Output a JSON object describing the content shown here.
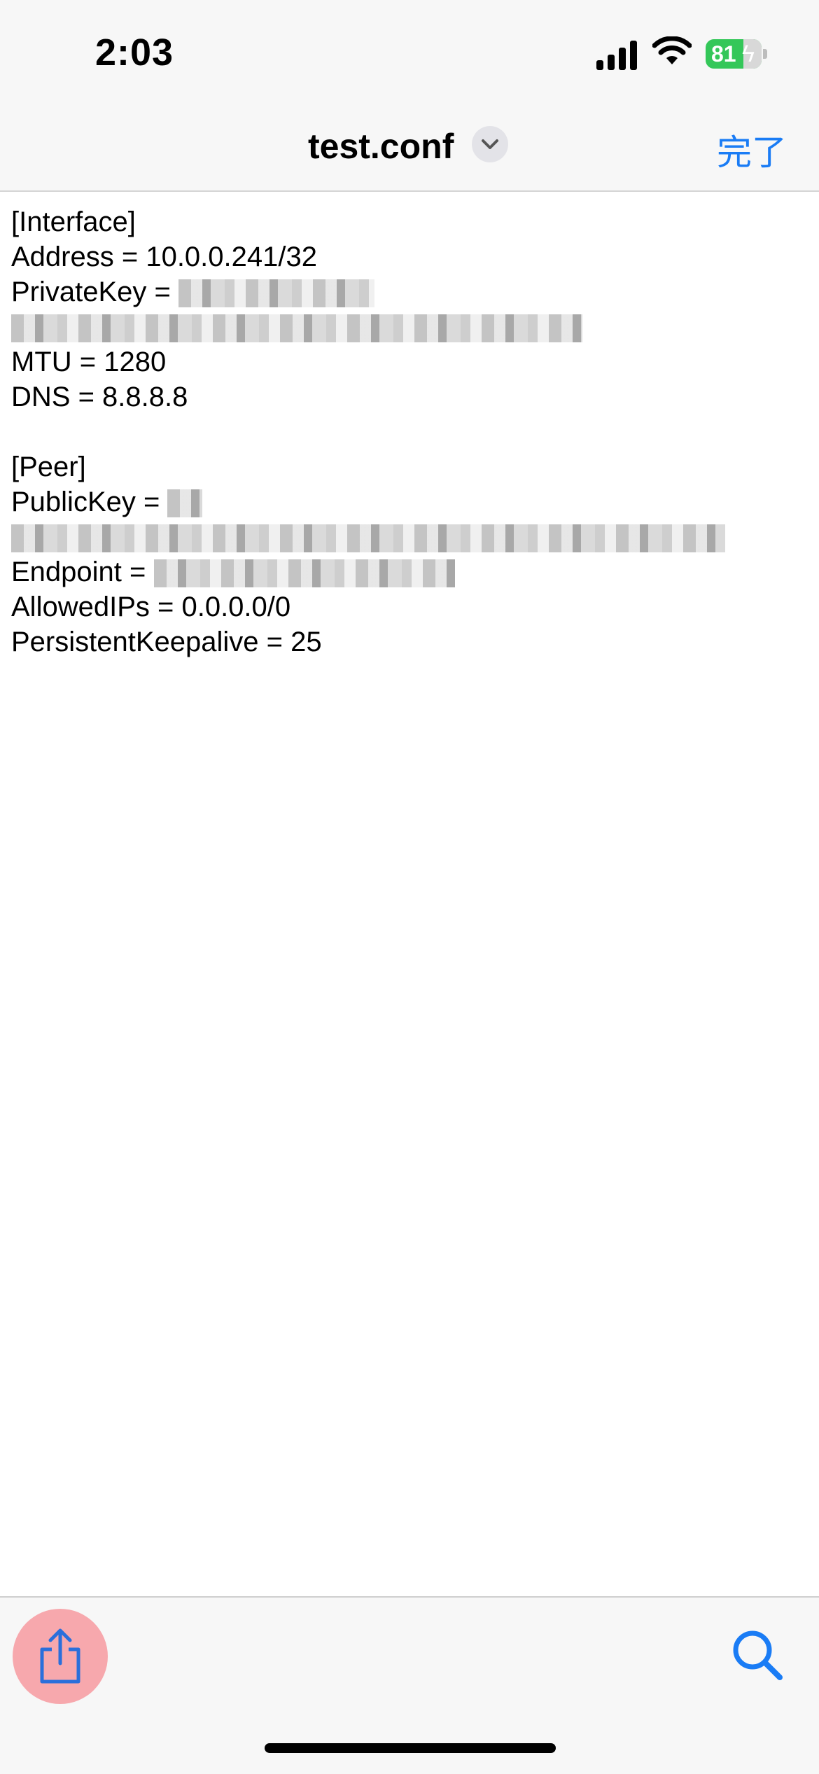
{
  "status_bar": {
    "time": "2:03",
    "battery": "81"
  },
  "nav": {
    "title": "test.conf",
    "done_label": "完了"
  },
  "config": {
    "interface_header": "[Interface]",
    "address": "Address = 10.0.0.241/32",
    "private_key_label": "PrivateKey =",
    "mtu": "MTU = 1280",
    "dns": "DNS = 8.8.8.8",
    "peer_header": "[Peer]",
    "public_key_label": "PublicKey =",
    "endpoint_label": "Endpoint =",
    "allowed_ips": "AllowedIPs = 0.0.0.0/0",
    "keepalive": "PersistentKeepalive = 25"
  },
  "icons": {
    "share": "share-icon",
    "search": "search-icon",
    "chevron": "chevron-down-icon"
  },
  "colors": {
    "accent": "#1a7cf5",
    "battery": "#34c759",
    "share_button": "#f7a8ad"
  }
}
